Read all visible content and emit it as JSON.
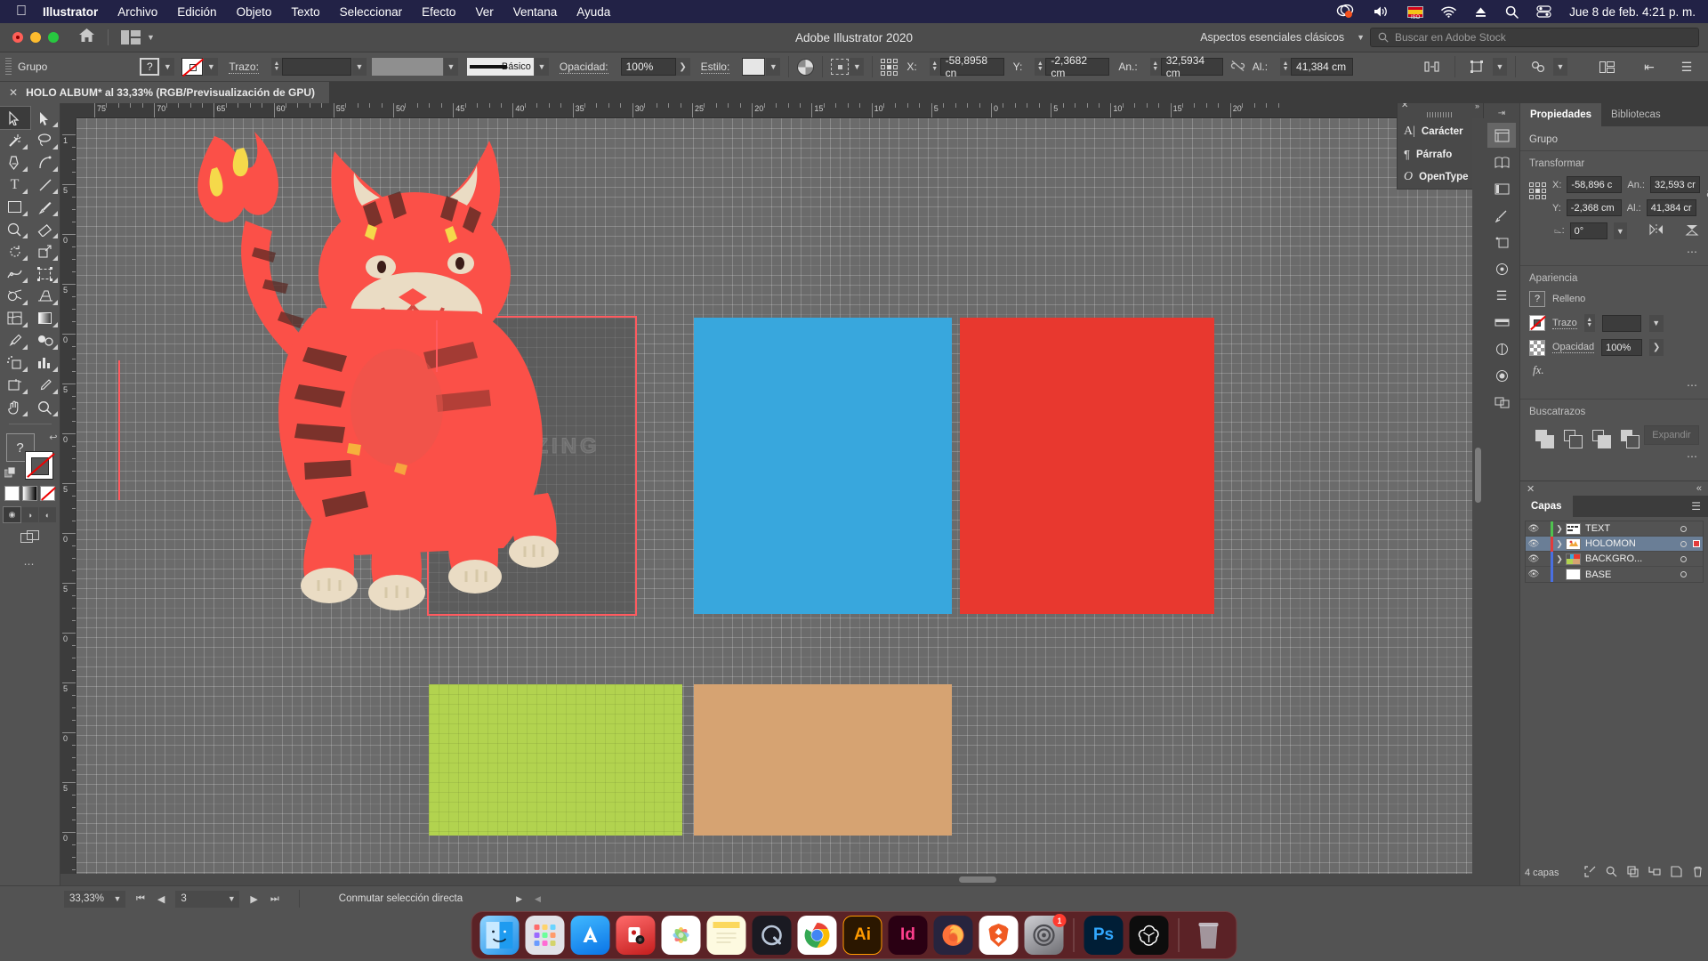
{
  "menubar": {
    "apple_icon": "apple-icon",
    "items": [
      {
        "label": "Illustrator",
        "bold": true
      },
      {
        "label": "Archivo",
        "bold": false
      },
      {
        "label": "Edición",
        "bold": false
      },
      {
        "label": "Objeto",
        "bold": false
      },
      {
        "label": "Texto",
        "bold": false
      },
      {
        "label": "Seleccionar",
        "bold": false
      },
      {
        "label": "Efecto",
        "bold": false
      },
      {
        "label": "Ver",
        "bold": false
      },
      {
        "label": "Ventana",
        "bold": false
      },
      {
        "label": "Ayuda",
        "bold": false
      }
    ],
    "status_icons": [
      "screen-share-icon",
      "volume-icon",
      "spanish-keyboard-flag-icon",
      "wifi-icon",
      "eject-icon",
      "spotlight-search-icon",
      "control-center-icon"
    ],
    "clock": "Jue 8 de feb.  4:21 p. m."
  },
  "titlebar": {
    "app_title": "Adobe Illustrator 2020",
    "home_icon": "home-icon",
    "arrange_icon": "arrange-documents-icon",
    "workspace": "Aspectos esenciales clásicos",
    "stock_placeholder": "Buscar en Adobe Stock"
  },
  "controlbar": {
    "selection_label": "Grupo",
    "fill_swatch": "?",
    "stroke_swatch": "none-swatch-icon",
    "stroke_label": "Trazo:",
    "stroke_weight": "",
    "stroke_profile": "",
    "brush_label": "Básico",
    "opacity_label": "Opacidad:",
    "opacity_value": "100%",
    "style_label": "Estilo:",
    "recolor_icon": "recolor-artwork-icon",
    "align_icon": "align-icon",
    "transform_ref_icon": "reference-point-icon",
    "x_label": "X:",
    "x_value": "-58,8958 cn",
    "y_label": "Y:",
    "y_value": "-2,3682 cm",
    "w_label": "An.:",
    "w_value": "32,5934 cm",
    "lock_icon": "unlink-proportions-icon",
    "h_label": "Al.:",
    "h_value": "41,384 cm",
    "distribute_icon": "distribute-icon",
    "transform_icon": "transform-icon",
    "more_icon": "more-options-icon"
  },
  "document": {
    "tab_title": "HOLO ALBUM* al 33,33% (RGB/Previsualización de GPU)",
    "close_icon": "close-tab-icon"
  },
  "toolbar": {
    "tools": [
      {
        "name": "selection-tool",
        "glyph": "selection"
      },
      {
        "name": "direct-selection-tool",
        "glyph": "direct"
      },
      {
        "name": "magic-wand-tool",
        "glyph": "wand"
      },
      {
        "name": "lasso-tool",
        "glyph": "lasso"
      },
      {
        "name": "pen-tool",
        "glyph": "pen"
      },
      {
        "name": "curvature-tool",
        "glyph": "curvature"
      },
      {
        "name": "type-tool",
        "glyph": "T"
      },
      {
        "name": "line-segment-tool",
        "glyph": "line"
      },
      {
        "name": "rectangle-tool",
        "glyph": "rect"
      },
      {
        "name": "paintbrush-tool",
        "glyph": "brush"
      },
      {
        "name": "shaper-tool",
        "glyph": "shaper"
      },
      {
        "name": "eraser-tool",
        "glyph": "eraser"
      },
      {
        "name": "rotate-tool",
        "glyph": "rotate"
      },
      {
        "name": "scale-tool",
        "glyph": "scale"
      },
      {
        "name": "width-tool",
        "glyph": "width"
      },
      {
        "name": "free-transform-tool",
        "glyph": "freetransform"
      },
      {
        "name": "shape-builder-tool",
        "glyph": "shapebuilder"
      },
      {
        "name": "perspective-grid-tool",
        "glyph": "perspective"
      },
      {
        "name": "mesh-tool",
        "glyph": "mesh"
      },
      {
        "name": "gradient-tool",
        "glyph": "gradient"
      },
      {
        "name": "eyedropper-tool",
        "glyph": "eyedropper"
      },
      {
        "name": "blend-tool",
        "glyph": "blend"
      },
      {
        "name": "symbol-sprayer-tool",
        "glyph": "sprayer"
      },
      {
        "name": "column-graph-tool",
        "glyph": "graph"
      },
      {
        "name": "artboard-tool",
        "glyph": "artboard"
      },
      {
        "name": "slice-tool",
        "glyph": "slice"
      },
      {
        "name": "hand-tool",
        "glyph": "hand"
      },
      {
        "name": "zoom-tool",
        "glyph": "zoom"
      }
    ],
    "fill_value": "?",
    "stroke_value": "none",
    "color_modes": [
      "white-fill-icon",
      "gradient-fill-icon",
      "none-fill-icon"
    ],
    "draw_modes": [
      "draw-normal-icon",
      "draw-behind-icon",
      "draw-inside-icon"
    ],
    "screen_mode_icon": "screen-mode-icon",
    "more_tools_icon": "edit-toolbar-icon"
  },
  "canvas": {
    "ruler_h_labels": [
      "75",
      "70",
      "65",
      "60",
      "55",
      "50",
      "45",
      "40",
      "35",
      "30",
      "25",
      "20",
      "15",
      "10",
      "5",
      "0",
      "5",
      "10",
      "15",
      "20"
    ],
    "ruler_v_labels": [
      "1",
      "5",
      "0",
      "5",
      "0",
      "5",
      "0",
      "5",
      "0",
      "5",
      "0",
      "5",
      "0",
      "5",
      "0",
      "5"
    ],
    "holozing_text": "HOLOZING",
    "artboards": [
      {
        "name": "artboard-album-cover",
        "color": "#5c5c5c"
      },
      {
        "name": "artboard-blue",
        "color": "#38a7dd"
      },
      {
        "name": "artboard-red",
        "color": "#e8382f"
      },
      {
        "name": "artboard-green",
        "color": "#b2d34f"
      },
      {
        "name": "artboard-tan",
        "color": "#d6a372"
      }
    ],
    "character_panel": {
      "close_icon": "close-icon",
      "collapse_icon": "expand-panel-icon",
      "items": [
        {
          "icon": "character-icon",
          "label": "Carácter"
        },
        {
          "icon": "paragraph-icon",
          "label": "Párrafo"
        },
        {
          "icon": "opentype-icon",
          "label": "OpenType"
        }
      ]
    }
  },
  "dockstrip": {
    "collapse_icon": "collapse-panels-icon",
    "buttons": [
      "properties-icon",
      "libraries-icon",
      "color-guide-icon",
      "brushes-icon",
      "symbols-icon",
      "swatches-icon",
      "align-icon",
      "transform-icon",
      "appearance-icon",
      "graphic-styles-icon",
      "artboards-icon"
    ]
  },
  "properties": {
    "tabs": [
      {
        "label": "Propiedades",
        "active": true
      },
      {
        "label": "Bibliotecas",
        "active": false
      }
    ],
    "selection_type": "Grupo",
    "transform": {
      "heading": "Transformar",
      "ref_point_icon": "reference-point-icon",
      "x_label": "X:",
      "x_value": "-58,896 c",
      "y_label": "Y:",
      "y_value": "-2,368 cm",
      "w_label": "An.:",
      "w_value": "32,593 cr",
      "h_label": "Al.:",
      "h_value": "41,384 cr",
      "angle_label": "⌳:",
      "angle_value": "0°",
      "link_icon": "unlink-proportions-icon",
      "flip_h_icon": "flip-horizontal-icon",
      "flip_v_icon": "flip-vertical-icon",
      "more_icon": "more-options-icon"
    },
    "appearance": {
      "heading": "Apariencia",
      "fill_label": "Relleno",
      "fill_swatch": "?",
      "stroke_label": "Trazo",
      "stroke_swatch": "none-swatch-icon",
      "stroke_weight": "",
      "opacity_label": "Opacidad",
      "opacity_value": "100%",
      "fx_label": "fx.",
      "more_icon": "more-options-icon"
    },
    "pathfinder": {
      "heading": "Buscatrazos",
      "buttons": [
        "unite-icon",
        "minus-front-icon",
        "intersect-icon",
        "exclude-icon"
      ],
      "expand_label": "Expandir",
      "more_icon": "more-options-icon"
    }
  },
  "layers": {
    "close_icon": "close-icon",
    "collapse_icon": "collapse-icon",
    "tab_label": "Capas",
    "menu_icon": "panel-menu-icon",
    "rows": [
      {
        "name": "TEXT",
        "color": "#4fc24f",
        "selected": false,
        "has_children": true,
        "thumb": "text-thumb"
      },
      {
        "name": "HOLOMON",
        "color": "#e23b3b",
        "selected": true,
        "has_children": true,
        "thumb": "holomon-thumb"
      },
      {
        "name": "BACKGRO...",
        "color": "#4a6fe0",
        "selected": false,
        "has_children": true,
        "thumb": "background-thumb"
      },
      {
        "name": "BASE",
        "color": "#4a6fe0",
        "selected": false,
        "has_children": false,
        "thumb": "base-thumb"
      }
    ],
    "footer_count": "4 capas",
    "footer_icons": [
      "locate-object-icon",
      "search-icon",
      "make-clipping-mask-icon",
      "create-sublayer-icon",
      "new-layer-icon",
      "delete-layer-icon"
    ]
  },
  "statusbar": {
    "zoom_value": "33,33%",
    "zoom_chevron": "chevron-down-icon",
    "first_artboard_icon": "first-artboard-icon",
    "prev_artboard_icon": "previous-artboard-icon",
    "artboard_number": "3",
    "artboard_chevron": "chevron-down-icon",
    "next_artboard_icon": "next-artboard-icon",
    "last_artboard_icon": "last-artboard-icon",
    "status_text": "Conmutar selección directa",
    "status_chevron": "status-menu-icon"
  },
  "macdock": {
    "apps": [
      {
        "name": "finder",
        "label": "",
        "bg": "#1e9bf0",
        "glyph": "finder"
      },
      {
        "name": "launchpad",
        "label": "",
        "bg": "#d8d8de",
        "glyph": "launchpad"
      },
      {
        "name": "app-store",
        "label": "",
        "bg": "#1b8cf5",
        "glyph": "appstore"
      },
      {
        "name": "podcasts",
        "label": "",
        "bg": "#e03131",
        "glyph": "podcasts"
      },
      {
        "name": "photos",
        "label": "",
        "bg": "#ffffff",
        "glyph": "photos"
      },
      {
        "name": "notes",
        "label": "",
        "bg": "#fbf0c0",
        "glyph": "notes"
      },
      {
        "name": "quicktime",
        "label": "",
        "bg": "#1b1b22",
        "glyph": "quicktime"
      },
      {
        "name": "google-chrome",
        "label": "",
        "bg": "#ffffff",
        "glyph": "chrome"
      },
      {
        "name": "adobe-illustrator",
        "label": "Ai",
        "bg": "#2b1700",
        "glyph": "text"
      },
      {
        "name": "adobe-indesign",
        "label": "Id",
        "bg": "#2a0013",
        "glyph": "text"
      },
      {
        "name": "firefox",
        "label": "",
        "bg": "#1b1b3a",
        "glyph": "firefox"
      },
      {
        "name": "brave-browser",
        "label": "",
        "bg": "#ffffff",
        "glyph": "brave"
      },
      {
        "name": "system-settings",
        "label": "",
        "bg": "#8a8a8e",
        "glyph": "settings",
        "badge": "1"
      },
      {
        "name": "adobe-photoshop",
        "label": "Ps",
        "bg": "#001e36",
        "glyph": "text"
      },
      {
        "name": "chatgpt",
        "label": "",
        "bg": "#000000",
        "glyph": "openai"
      },
      {
        "name": "trash",
        "label": "",
        "bg": "transparent",
        "glyph": "trash"
      }
    ]
  }
}
